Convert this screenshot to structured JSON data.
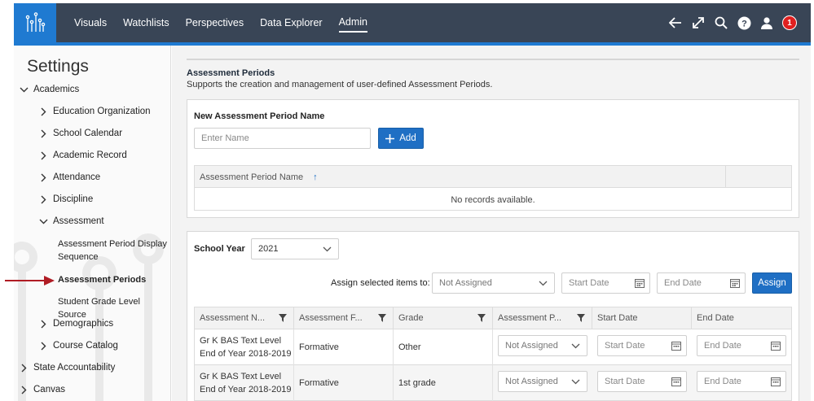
{
  "nav": {
    "items": [
      "Visuals",
      "Watchlists",
      "Perspectives",
      "Data Explorer",
      "Admin"
    ],
    "active": "Admin",
    "notification_count": "1",
    "colors": {
      "bar": "#394556",
      "accent": "#1f7ad1",
      "badge": "#e02020"
    }
  },
  "sidebar": {
    "title": "Settings",
    "academics": "Academics",
    "items": {
      "education_org": "Education Organization",
      "school_calendar": "School Calendar",
      "academic_record": "Academic Record",
      "attendance": "Attendance",
      "discipline": "Discipline",
      "assessment": "Assessment",
      "assessment_period_display_sequence": "Assessment Period Display Sequence",
      "assessment_periods": "Assessment Periods",
      "student_grade_level_source": "Student Grade Level Source",
      "demographics": "Demographics",
      "course_catalog": "Course Catalog",
      "state_accountability": "State Accountability",
      "canvas": "Canvas"
    }
  },
  "main": {
    "title": "Assessment Periods",
    "description": "Supports the creation and management of user-defined Assessment Periods.",
    "new_panel": {
      "label": "New Assessment Period Name",
      "name_placeholder": "Enter Name",
      "add_label": "Add",
      "grid_header": "Assessment Period Name",
      "sort_glyph": "↑",
      "empty_text": "No records available."
    },
    "school_year_panel": {
      "label": "School Year",
      "year": "2021",
      "assign_label": "Assign selected items to:",
      "assign_select": "Not Assigned",
      "start_placeholder": "Start Date",
      "end_placeholder": "End Date",
      "assign_button": "Assign",
      "columns": [
        "Assessment N...",
        "Assessment F...",
        "Grade",
        "Assessment P...",
        "Start Date",
        "End Date"
      ],
      "rows": [
        {
          "name_line1": "Gr K BAS Text Level",
          "name_line2": "End of Year 2018-2019",
          "format": "Formative",
          "grade": "Other",
          "period": "Not Assigned",
          "start": "Start Date",
          "end": "End Date"
        },
        {
          "name_line1": "Gr K BAS Text Level",
          "name_line2": "End of Year 2018-2019",
          "format": "Formative",
          "grade": "1st grade",
          "period": "Not Assigned",
          "start": "Start Date",
          "end": "End Date"
        }
      ]
    }
  }
}
